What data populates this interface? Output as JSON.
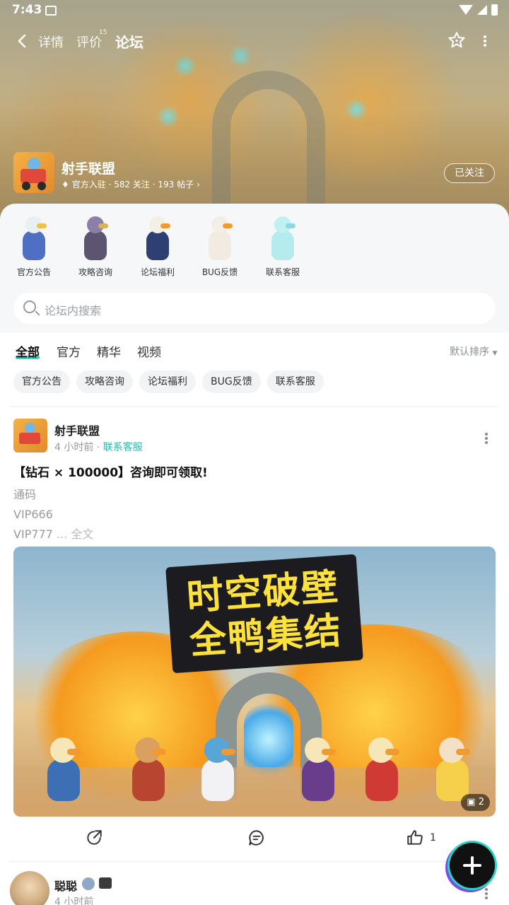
{
  "status_bar": {
    "time": "7:43"
  },
  "nav": {
    "tabs": [
      {
        "label": "详情"
      },
      {
        "label": "评价",
        "badge": "15"
      },
      {
        "label": "论坛"
      }
    ],
    "active_tab": "论坛"
  },
  "forum": {
    "name": "射手联盟",
    "meta": "官方入驻 · 582 关注 · 193 帖子",
    "follow_label": "已关注"
  },
  "categories": [
    {
      "label": "官方公告"
    },
    {
      "label": "攻略咨询"
    },
    {
      "label": "论坛福利"
    },
    {
      "label": "BUG反馈"
    },
    {
      "label": "联系客服"
    }
  ],
  "search": {
    "placeholder": "论坛内搜索"
  },
  "filter_tabs": [
    {
      "label": "全部"
    },
    {
      "label": "官方"
    },
    {
      "label": "精华"
    },
    {
      "label": "视频"
    }
  ],
  "sort_label": "默认排序",
  "chips": [
    "官方公告",
    "攻略咨询",
    "论坛福利",
    "BUG反馈",
    "联系客服"
  ],
  "post": {
    "author": "射手联盟",
    "time": "4 小时前",
    "board": "联系客服",
    "title": "【钻石 × 100000】咨询即可领取!",
    "lines": [
      "通码",
      "VIP666",
      "VIP777"
    ],
    "ellipsis": "...",
    "read_more": "全文",
    "image_title_line1": "时空破壁",
    "image_title_line2": "全鸭集结",
    "image_count": "2",
    "like_count": "1"
  },
  "post2": {
    "author": "聪聪",
    "time": "4 小时前"
  },
  "colors": {
    "accent": "#29d3c0",
    "board_link": "#1fbfad",
    "fab": "#111111"
  }
}
